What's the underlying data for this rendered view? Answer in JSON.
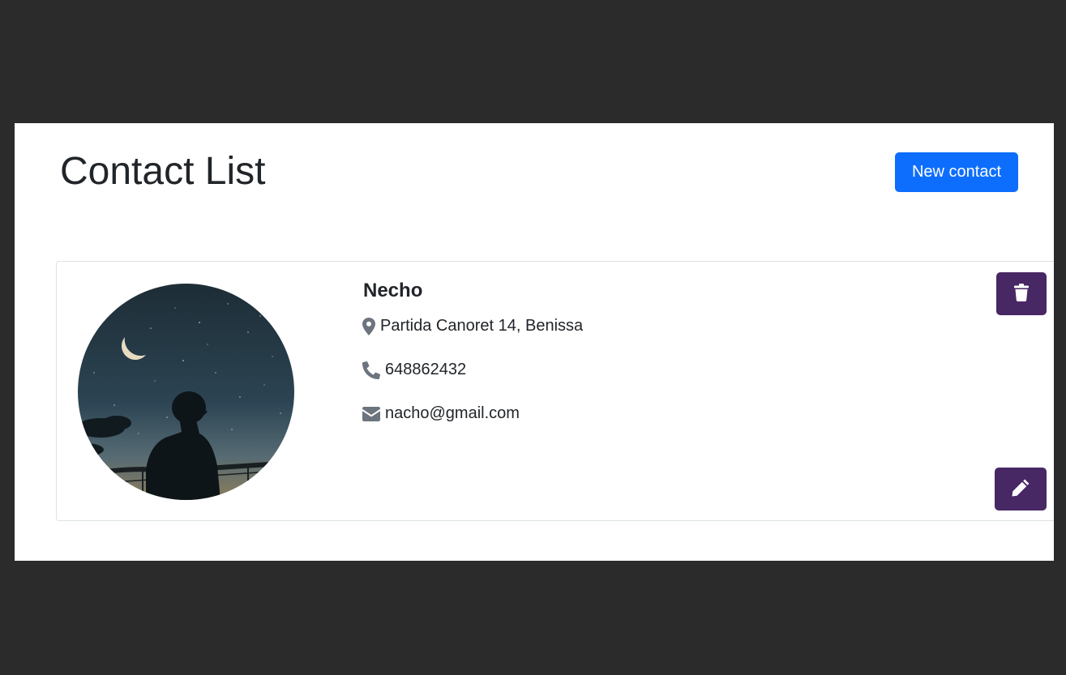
{
  "page": {
    "title": "Contact List",
    "new_contact_label": "New contact"
  },
  "contact": {
    "name": "Necho",
    "address": "Partida Canoret 14, Benissa",
    "phone": "648862432",
    "email": "nacho@gmail.com",
    "avatar_alt": "Silhouette under a night sky"
  },
  "icons": {
    "address": "map-marker-icon",
    "phone": "phone-icon",
    "email": "envelope-icon",
    "delete": "trash-icon",
    "edit": "pencil-icon"
  },
  "colors": {
    "background": "#2b2b2b",
    "primary_button": "#0d6efd",
    "action_button": "#482765",
    "icon_gray": "#6c757d"
  }
}
